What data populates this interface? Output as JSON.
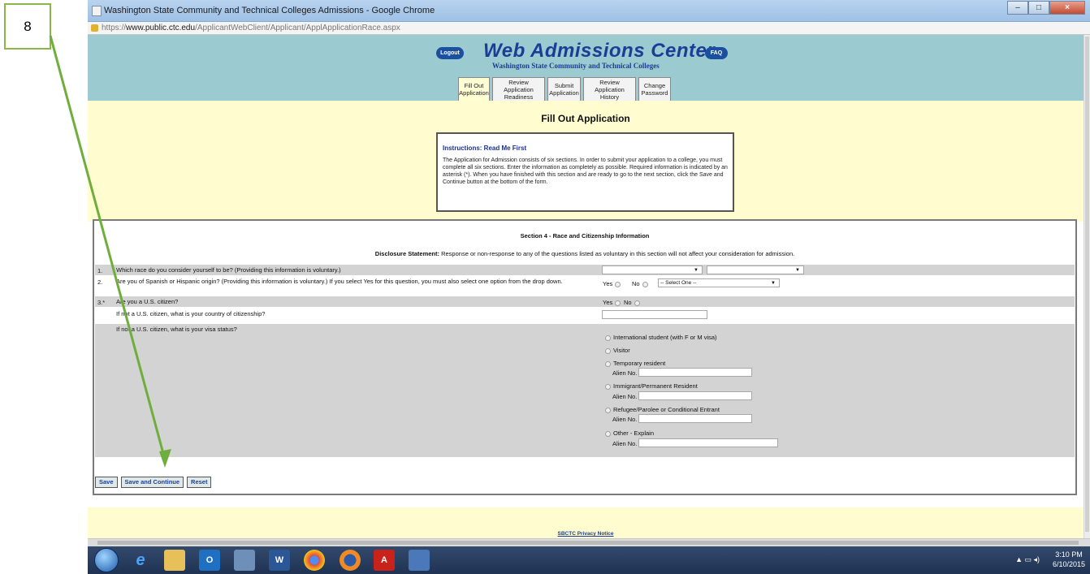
{
  "step": {
    "number": "8"
  },
  "window": {
    "title": "Washington State Community and Technical Colleges Admissions - Google Chrome"
  },
  "address": {
    "scheme": "https://",
    "host": "www.public.ctc.edu",
    "path": "/ApplicantWebClient/Applicant/ApplApplicationRace.aspx"
  },
  "header": {
    "logout": "Logout",
    "faq": "FAQ",
    "title": "Web Admissions Center",
    "subtitle": "Washington State Community and Technical Colleges",
    "tabs": [
      {
        "line1": "Fill Out",
        "line2": "Application"
      },
      {
        "line1": "Review Application",
        "line2": "Readiness"
      },
      {
        "line1": "Submit",
        "line2": "Application"
      },
      {
        "line1": "Review Application",
        "line2": "History"
      },
      {
        "line1": "Change",
        "line2": "Password"
      }
    ]
  },
  "main": {
    "heading": "Fill Out Application",
    "instructions_title": "Instructions: Read Me First",
    "instructions_text": "The Application for Admission consists of six sections. In order to submit your application to a college, you must complete all six sections. Enter the information as completely as possible. Required information is indicated by an asterisk (*). When you have finished with this section and are ready to go to the next section, click the Save and Continue button at the bottom of the form."
  },
  "section": {
    "title": "Section 4 - Race and Citizenship Information",
    "disclosure_label": "Disclosure Statement:",
    "disclosure_text": "Response or non-response to any of the questions listed as voluntary in this section will not affect your consideration for admission.",
    "q1": {
      "num": "1.",
      "text": "Which race do you consider yourself to be? (Providing this information is voluntary.)"
    },
    "q2": {
      "num": "2.",
      "text": "Are you of Spanish or Hispanic origin? (Providing this information is voluntary.) If you select Yes for this question, you must also select one option from the drop down.",
      "select": "-- Select One --"
    },
    "q3": {
      "num": "3.*",
      "text": "Are you a U.S. citizen?"
    },
    "q3a": {
      "text": "If not a U.S. citizen, what is your country of citizenship?"
    },
    "q3b": {
      "text": "If not a U.S. citizen, what is your visa status?"
    },
    "yes": "Yes",
    "no": "No",
    "alien_label": "Alien No.",
    "visa_options": [
      "International student (with F or M visa)",
      "Visitor",
      "Temporary resident",
      "Immigrant/Permanent Resident",
      "Refugee/Parolee or Conditional Entrant",
      "Other - Explain"
    ]
  },
  "buttons": {
    "save": "Save",
    "save_continue": "Save and Continue",
    "reset": "Reset"
  },
  "footer": {
    "privacy": "SBCTC Privacy Notice"
  },
  "taskbar": {
    "time": "3:10 PM",
    "date": "6/10/2015"
  }
}
